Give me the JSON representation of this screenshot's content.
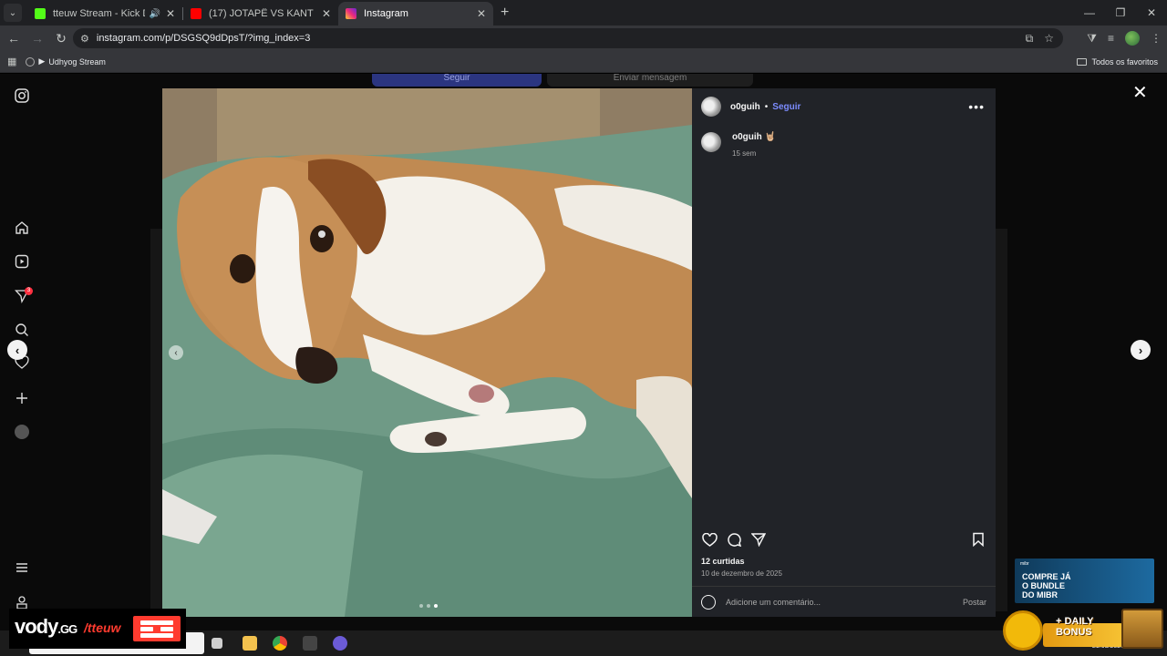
{
  "browser": {
    "tabs": [
      {
        "title": "tteuw Stream - Kick Dashboard",
        "favicon_color": "#53fc18",
        "audio": true,
        "active": false
      },
      {
        "title": "(17) JOTAPÊ VS KANT | #FMSBRASIL",
        "favicon_color": "#ff0000",
        "audio": false,
        "active": false
      },
      {
        "title": "Instagram",
        "favicon_color": "#e1306c",
        "audio": false,
        "active": true
      }
    ],
    "url": "instagram.com/p/DSGSQ9dDpsT/?img_index=3",
    "bookmark": "Udhyog Stream",
    "all_favorites": "Todos os favoritos"
  },
  "instagram": {
    "bg_follow_label": "Seguir",
    "bg_message_label": "Enviar mensagem",
    "notification_count": "3",
    "post": {
      "username": "o0guih",
      "follow_label": "Seguir",
      "separator": "•",
      "caption_user": "o0guih",
      "caption_emoji": "🤘🏼",
      "caption_time": "15 sem",
      "likes": "12 curtidas",
      "date": "10 de dezembro de 2025",
      "comment_placeholder": "Adicione um comentário...",
      "post_label": "Postar",
      "carousel_index": 3,
      "carousel_total": 3
    }
  },
  "overlays": {
    "vody_brand": "vody",
    "vody_domain": ".GG",
    "vody_channel": "/tteuw",
    "ad_brand": "mibr",
    "ad_text": [
      "COMPRE JÁ",
      "O BUNDLE",
      "DO MIBR"
    ],
    "bonus_text": [
      "+ DAILY",
      "BONUS"
    ]
  },
  "taskbar": {
    "date": "29/03/2026"
  }
}
